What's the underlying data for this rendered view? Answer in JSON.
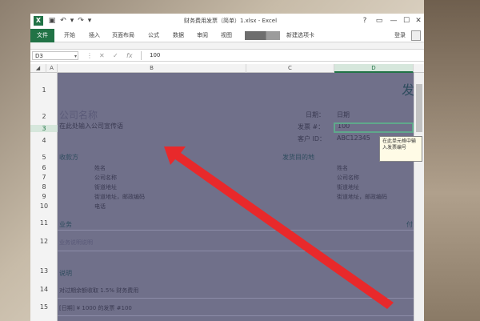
{
  "titlebar": {
    "title": "财务费用发票（简单）1.xlsx - Excel",
    "help": "?",
    "restore": "▭",
    "minimize": "—",
    "maximize": "☐",
    "close": "✕"
  },
  "ribbon": {
    "file": "文件",
    "tabs": [
      "开始",
      "插入",
      "页面布局",
      "公式",
      "数据",
      "审阅",
      "视图",
      "新建选项卡"
    ],
    "login": "登录"
  },
  "formula_bar": {
    "namebox": "D3",
    "cancel": "✕",
    "enter": "✓",
    "fx": "fx",
    "value": "100"
  },
  "columns": [
    "A",
    "B",
    "C",
    "D"
  ],
  "rows": [
    "1",
    "2",
    "3",
    "4",
    "5",
    "6",
    "7",
    "8",
    "9",
    "10",
    "11",
    "12",
    "13",
    "14",
    "15"
  ],
  "sheet": {
    "title_partial": "发",
    "company_name": "公司名称",
    "company_slogan": "在此处输入公司宣传语",
    "date_label": "日期：",
    "date_value": "日期",
    "invoice_label": "发票 #：",
    "invoice_value": "100",
    "customer_label": "客户 ID：",
    "customer_value": "ABC12345",
    "payer_header": "收款方",
    "payer_lines": [
      "姓名",
      "公司名称",
      "街道地址",
      "街道地址，邮政编码",
      "电话"
    ],
    "shipto_header": "发货目的地",
    "shipto_lines": [
      "姓名",
      "公司名称",
      "街道地址",
      "街道地址，邮政编码"
    ],
    "service_header": "业务",
    "service_partial": "付",
    "service_desc": "业务说明说明",
    "notes_header": "说明",
    "note_1": "对过期余额收取 1.5% 财务费用",
    "note_2": "[日期] ¥ 1000 的发票 #100"
  },
  "tooltip": "在此单元格中输入发票编号",
  "colors": {
    "excel_green": "#217346",
    "sheet_overlay": "#70708a",
    "arrow": "#e8292b"
  }
}
